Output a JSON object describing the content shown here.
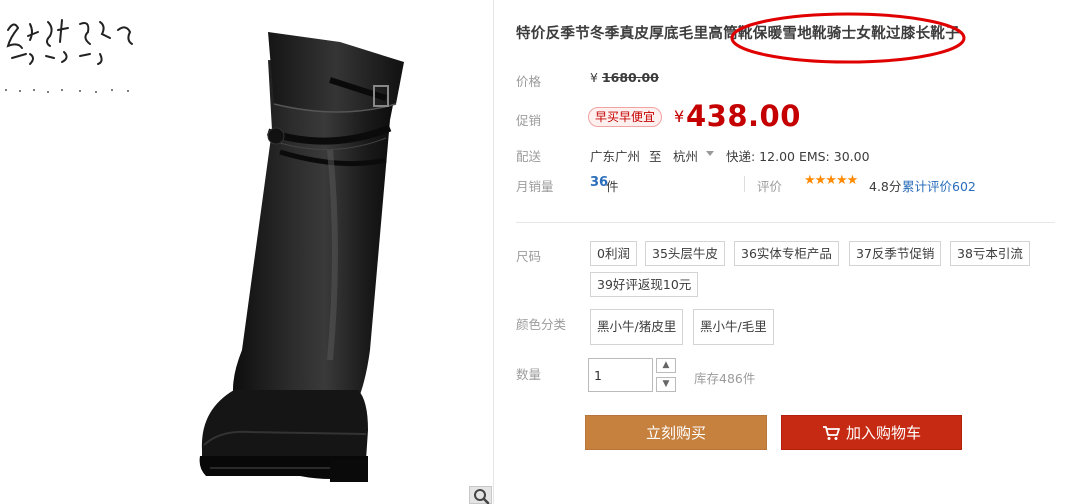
{
  "product": {
    "title": "特价反季节冬季真皮厚底毛里高筒靴保暖雪地靴骑士女靴过膝长靴子",
    "price_label": "价格",
    "currency": "¥",
    "original_price": "1680.00",
    "promo_label": "促销",
    "promo_badge": "早买早便宜",
    "promo_price": "438.00",
    "shipping_label": "配送",
    "ship_from": "广东广州",
    "ship_to_word": "至",
    "ship_dest": "杭州",
    "shipping_fee": "快递: 12.00 EMS: 30.00",
    "sales_label": "月销量",
    "sales_count": "36",
    "sales_unit": "件",
    "review_label": "评价",
    "review_stars": "★★★★★",
    "review_score": "4.8分",
    "review_link": "累计评价602"
  },
  "sizes": {
    "label": "尺码",
    "options": [
      "0利润",
      "35头层牛皮",
      "36实体专柜产品",
      "37反季节促销",
      "38亏本引流",
      "39好评返现10元"
    ]
  },
  "colors": {
    "label": "颜色分类",
    "options": [
      "黑小牛/猪皮里",
      "黑小牛/毛里"
    ]
  },
  "quantity": {
    "label": "数量",
    "value": "1",
    "stock": "库存486件"
  },
  "actions": {
    "buy_now": "立刻购买",
    "add_to_cart": "加入购物车"
  },
  "icons": {
    "zoom": "magnifier-icon",
    "cart": "cart-icon",
    "stepper_up": "chevron-up-icon",
    "stepper_down": "chevron-down-icon"
  },
  "colors_theme": {
    "price_red": "#c40000",
    "buy_orange": "#c6813f",
    "cart_red": "#c62a12",
    "link_blue": "#2a6ebb",
    "star_orange": "#ff8a00",
    "annotation_red": "#e00000"
  }
}
